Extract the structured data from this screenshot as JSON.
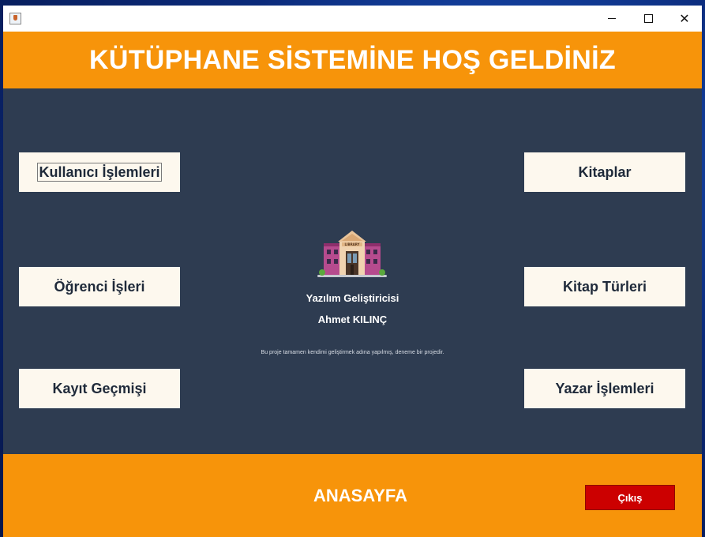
{
  "window": {
    "controls": {
      "minimize_icon": "minimize-icon",
      "maximize_icon": "maximize-icon",
      "close_glyph": "✕"
    }
  },
  "header": {
    "title": "KÜTÜPHANE SİSTEMİNE HOŞ GELDİNİZ",
    "color": "#f7940a"
  },
  "menu": {
    "left": [
      {
        "label": "Kullanıcı İşlemleri"
      },
      {
        "label": "Öğrenci İşleri"
      },
      {
        "label": "Kayıt Geçmişi"
      }
    ],
    "right": [
      {
        "label": "Kitaplar"
      },
      {
        "label": "Kitap Türleri"
      },
      {
        "label": "Yazar İşlemleri"
      }
    ]
  },
  "center": {
    "logo_text": "LIBRARY",
    "developer_title": "Yazılım Geliştiricisi",
    "developer_name": "Ahmet KILINÇ",
    "note": "Bu proje tamamen kendimi geliştirmek adına yapılmış, deneme bir projedir."
  },
  "footer": {
    "title": "ANASAYFA",
    "exit_label": "Çıkış",
    "exit_color": "#cc0000"
  },
  "colors": {
    "background": "#2e3c51",
    "button_bg": "#fdf8ee",
    "accent": "#f7940a"
  }
}
